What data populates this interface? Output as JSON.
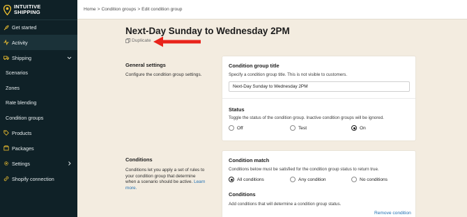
{
  "brand": {
    "line1": "INTUITIVE",
    "line2": "SHIPPING",
    "accent": "#f2c230"
  },
  "sidebar": {
    "items": [
      {
        "label": "Get started",
        "icon": "rocket-icon"
      },
      {
        "label": "Activity",
        "icon": "activity-icon"
      },
      {
        "label": "Shipping",
        "icon": "truck-icon"
      },
      {
        "label": "Scenarios"
      },
      {
        "label": "Zones"
      },
      {
        "label": "Rate blending"
      },
      {
        "label": "Condition groups"
      },
      {
        "label": "Products",
        "icon": "tag-icon"
      },
      {
        "label": "Packages",
        "icon": "package-icon"
      },
      {
        "label": "Settings",
        "icon": "gear-icon"
      },
      {
        "label": "Shopify connection",
        "icon": "link-icon"
      }
    ]
  },
  "breadcrumb": {
    "home": "Home",
    "groups": "Condition groups",
    "current": "Edit condition group",
    "sep": ">"
  },
  "page": {
    "title": "Next-Day Sunday to Wednesday 2PM",
    "duplicate_label": "Duplicate"
  },
  "general": {
    "title": "General settings",
    "desc": "Configure the condition group settings.",
    "card": {
      "title": "Condition group title",
      "desc": "Specify a condition group title. This is not visible to customers.",
      "value": "Next-Day Sunday to Wednesday 2PM",
      "status_title": "Status",
      "status_desc": "Toggle the status of the condition group. Inactive condition groups will be ignored.",
      "status_options": [
        "Off",
        "Test",
        "On"
      ],
      "status_selected": "On"
    }
  },
  "conditions": {
    "title": "Conditions",
    "desc": "Conditions let you apply a set of rules to your condition group that determine when a scenario should be active.",
    "learn_more": "Learn more.",
    "card": {
      "match_title": "Condition match",
      "match_desc": "Conditions below must be satisfied for the condition group status to return true.",
      "match_options": [
        "All conditions",
        "Any condition",
        "No conditions"
      ],
      "match_selected": "All conditions",
      "list_title": "Conditions",
      "list_desc": "Add conditions that will determine a condition group status.",
      "remove_label": "Remove condition"
    }
  }
}
